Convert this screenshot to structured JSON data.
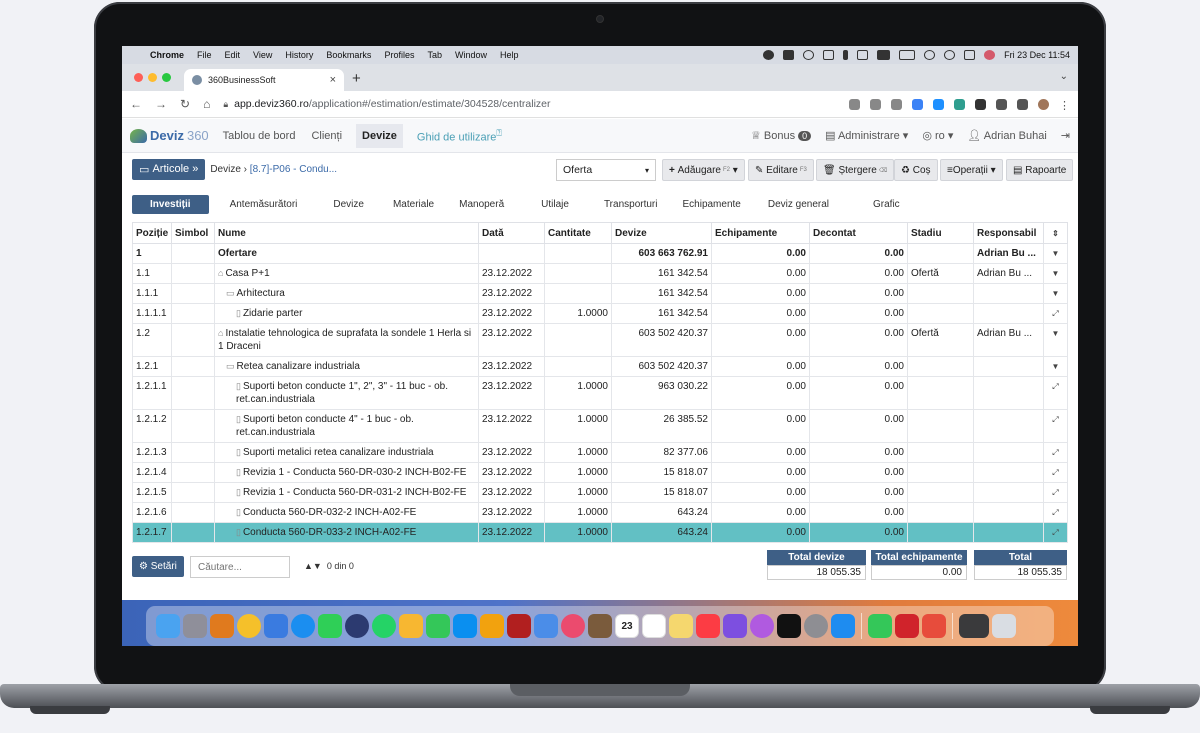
{
  "menubar": {
    "app": "Chrome",
    "items": [
      "File",
      "Edit",
      "View",
      "History",
      "Bookmarks",
      "Profiles",
      "Tab",
      "Window",
      "Help"
    ],
    "datetime": "Fri 23 Dec  11:54"
  },
  "browser": {
    "tab_title": "360BusinessSoft",
    "url_host": "app.deviz360.ro",
    "url_path": "/application#/estimation/estimate/304528/centralizer"
  },
  "app": {
    "logo_text": "Deviz",
    "logo_num": "360",
    "nav": [
      "Tablou de bord",
      "Clienți",
      "Devize",
      "Ghid de utilizare"
    ],
    "bonus_label": "Bonus",
    "bonus_count": "0",
    "admin_label": "Administrare",
    "lang_label": "ro",
    "user_name": "Adrian Buhai"
  },
  "toolbar": {
    "articole": "Articole",
    "crumb_devize": "Devize",
    "crumb_item": "[8.7]-P06 - Condu...",
    "select_value": "Oferta",
    "add": "Adăugare",
    "add_key": "F2",
    "edit": "Editare",
    "edit_key": "F3",
    "delete": "Ștergere",
    "delete_key": "⌫",
    "cos": "Coș",
    "operatii": "Operații",
    "rapoarte": "Rapoarte"
  },
  "tabs": [
    "Investiții",
    "Antemăsurători",
    "Devize",
    "Materiale",
    "Manoperă",
    "Utilaje",
    "Transporturi",
    "Echipamente",
    "Deviz general",
    "Grafic"
  ],
  "table": {
    "headers": [
      "Poziție",
      "Simbol",
      "Nume",
      "Dată",
      "Cantitate",
      "Devize",
      "Echipamente",
      "Decontat",
      "Stadiu",
      "Responsabil"
    ],
    "rows": [
      {
        "poz": "1",
        "simbol": "",
        "nume": "Ofertare",
        "data": "",
        "cant": "",
        "devize": "603 663 762.91",
        "echip": "0.00",
        "decontat": "0.00",
        "stadiu": "",
        "resp": "Adrian Bu ..."
      },
      {
        "poz": "1.1",
        "simbol": "",
        "nume": "Casa P+1",
        "data": "23.12.2022",
        "cant": "",
        "devize": "161 342.54",
        "echip": "0.00",
        "decontat": "0.00",
        "stadiu": "Ofertă",
        "resp": "Adrian Bu ..."
      },
      {
        "poz": "1.1.1",
        "simbol": "",
        "nume": "Arhitectura",
        "data": "23.12.2022",
        "cant": "",
        "devize": "161 342.54",
        "echip": "0.00",
        "decontat": "0.00",
        "stadiu": "",
        "resp": ""
      },
      {
        "poz": "1.1.1.1",
        "simbol": "",
        "nume": "Zidarie parter",
        "data": "23.12.2022",
        "cant": "1.0000",
        "devize": "161 342.54",
        "echip": "0.00",
        "decontat": "0.00",
        "stadiu": "",
        "resp": ""
      },
      {
        "poz": "1.2",
        "simbol": "",
        "nume": "Instalatie tehnologica de suprafata la sondele 1 Herla si 1 Draceni",
        "data": "23.12.2022",
        "cant": "",
        "devize": "603 502 420.37",
        "echip": "0.00",
        "decontat": "0.00",
        "stadiu": "Ofertă",
        "resp": "Adrian Bu ..."
      },
      {
        "poz": "1.2.1",
        "simbol": "",
        "nume": "Retea canalizare industriala",
        "data": "23.12.2022",
        "cant": "",
        "devize": "603 502 420.37",
        "echip": "0.00",
        "decontat": "0.00",
        "stadiu": "",
        "resp": ""
      },
      {
        "poz": "1.2.1.1",
        "simbol": "",
        "nume": "Suporti beton conducte 1\", 2\", 3\" - 11 buc - ob. ret.can.industriala",
        "data": "23.12.2022",
        "cant": "1.0000",
        "devize": "963 030.22",
        "echip": "0.00",
        "decontat": "0.00",
        "stadiu": "",
        "resp": ""
      },
      {
        "poz": "1.2.1.2",
        "simbol": "",
        "nume": "Suporti beton conducte 4\" - 1 buc - ob. ret.can.industriala",
        "data": "23.12.2022",
        "cant": "1.0000",
        "devize": "26 385.52",
        "echip": "0.00",
        "decontat": "0.00",
        "stadiu": "",
        "resp": ""
      },
      {
        "poz": "1.2.1.3",
        "simbol": "",
        "nume": "Suporti metalici retea canalizare industriala",
        "data": "23.12.2022",
        "cant": "1.0000",
        "devize": "82 377.06",
        "echip": "0.00",
        "decontat": "0.00",
        "stadiu": "",
        "resp": ""
      },
      {
        "poz": "1.2.1.4",
        "simbol": "",
        "nume": "Revizia 1 - Conducta 560-DR-030-2 INCH-B02-FE",
        "data": "23.12.2022",
        "cant": "1.0000",
        "devize": "15 818.07",
        "echip": "0.00",
        "decontat": "0.00",
        "stadiu": "",
        "resp": ""
      },
      {
        "poz": "1.2.1.5",
        "simbol": "",
        "nume": "Revizia 1 - Conducta 560-DR-031-2 INCH-B02-FE",
        "data": "23.12.2022",
        "cant": "1.0000",
        "devize": "15 818.07",
        "echip": "0.00",
        "decontat": "0.00",
        "stadiu": "",
        "resp": ""
      },
      {
        "poz": "1.2.1.6",
        "simbol": "",
        "nume": "Conducta 560-DR-032-2 INCH-A02-FE",
        "data": "23.12.2022",
        "cant": "1.0000",
        "devize": "643.24",
        "echip": "0.00",
        "decontat": "0.00",
        "stadiu": "",
        "resp": ""
      },
      {
        "poz": "1.2.1.7",
        "simbol": "",
        "nume": "Conducta 560-DR-033-2 INCH-A02-FE",
        "data": "23.12.2022",
        "cant": "1.0000",
        "devize": "643.24",
        "echip": "0.00",
        "decontat": "0.00",
        "stadiu": "",
        "resp": ""
      }
    ]
  },
  "footer": {
    "setari": "Setări",
    "search_placeholder": "Căutare...",
    "pager": "0 din 0",
    "total_devize_label": "Total devize",
    "total_devize_value": "18 055.35",
    "total_echip_label": "Total echipamente",
    "total_echip_value": "0.00",
    "total_label": "Total",
    "total_value": "18 055.35"
  },
  "colors": {
    "accent": "#3e5f86",
    "selected_row": "#62c0c4",
    "help_link": "#4a9fb5"
  }
}
